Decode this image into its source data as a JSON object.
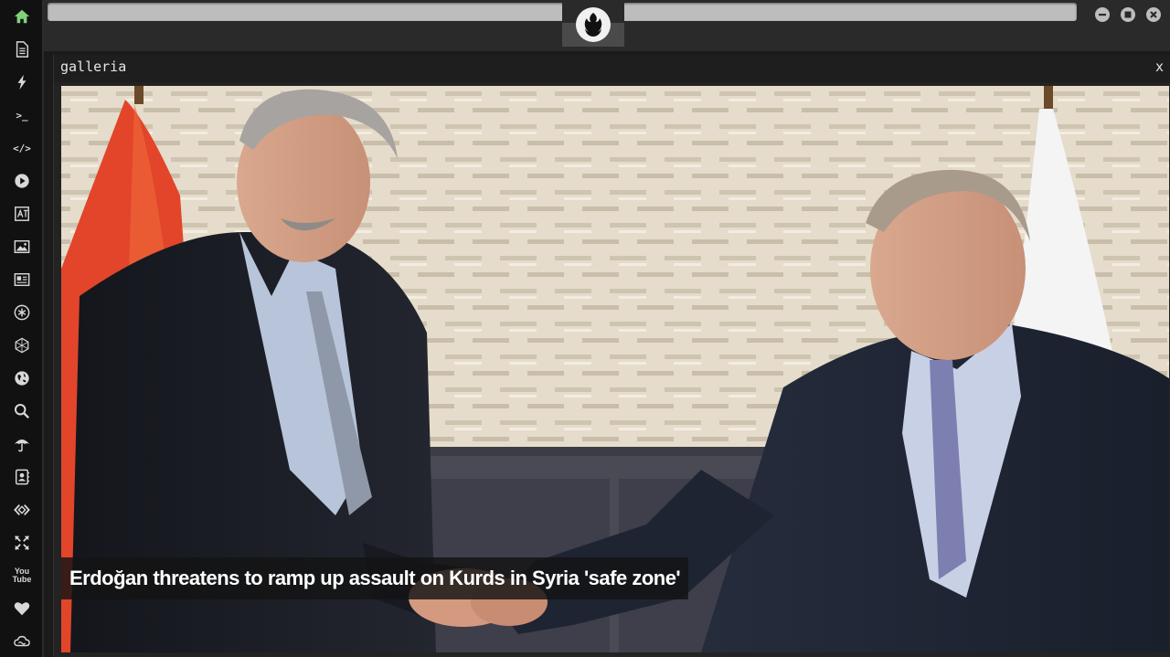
{
  "sidebar": {
    "items": [
      {
        "icon": "home-icon"
      },
      {
        "icon": "document-icon"
      },
      {
        "icon": "lightning-icon"
      },
      {
        "icon": "terminal-icon",
        "text": ">_"
      },
      {
        "icon": "code-icon",
        "text": "</>"
      },
      {
        "icon": "play-icon"
      },
      {
        "icon": "translate-icon"
      },
      {
        "icon": "image-icon"
      },
      {
        "icon": "newspaper-icon"
      },
      {
        "icon": "asterisk-circle-icon"
      },
      {
        "icon": "hexagon-icon"
      },
      {
        "icon": "globe-icon"
      },
      {
        "icon": "search-icon"
      },
      {
        "icon": "umbrella-icon"
      },
      {
        "icon": "contacts-icon"
      },
      {
        "icon": "code-diamond-icon"
      },
      {
        "icon": "expand-icon"
      },
      {
        "icon": "youtube-icon",
        "text": "You\nTube"
      },
      {
        "icon": "heart-icon"
      },
      {
        "icon": "cloud-icon"
      }
    ]
  },
  "topbar": {
    "logo_icon": "rebel-alliance-icon"
  },
  "gallery": {
    "title": "galleria",
    "close_label": "x",
    "caption": "Erdoğan threatens to ramp up assault on Kurds in Syria 'safe zone'"
  },
  "colors": {
    "accent_green": "#7fd37a",
    "sidebar_bg": "#111111",
    "topbar_bg": "#2a2a2a"
  }
}
